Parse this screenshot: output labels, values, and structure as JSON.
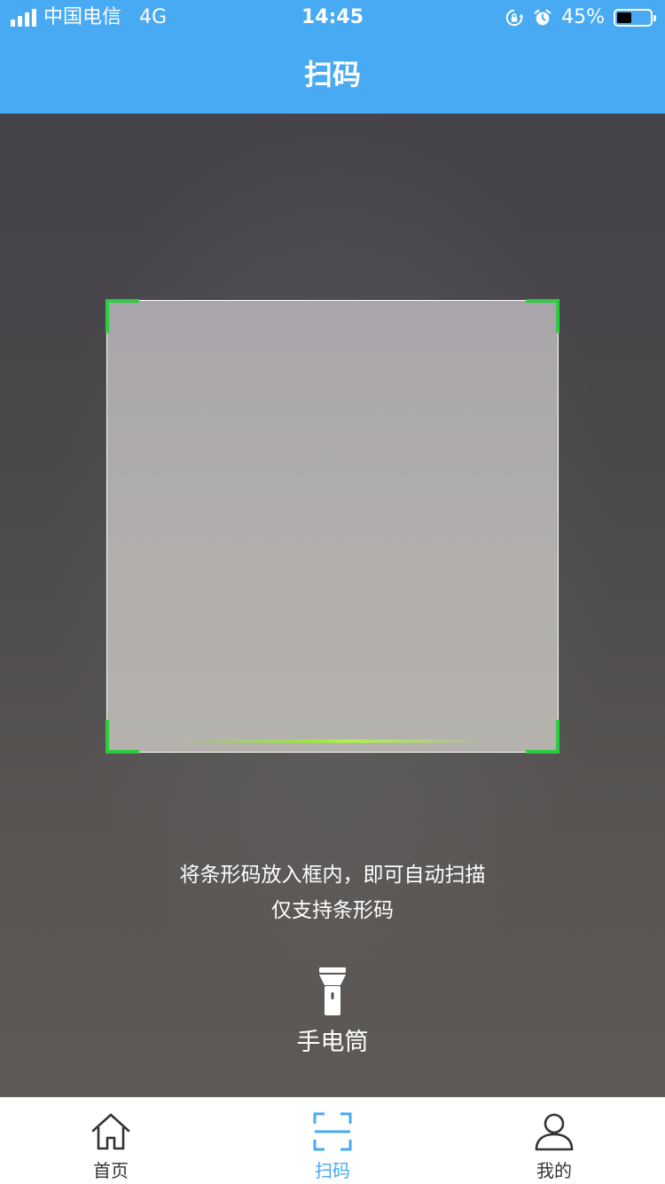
{
  "status_bar": {
    "carrier": "中国电信",
    "network": "4G",
    "time": "14:45",
    "battery_percent_text": "45%",
    "battery_level": 0.45,
    "icons": [
      "signal-icon",
      "orientation-lock-icon",
      "alarm-icon",
      "battery-icon"
    ]
  },
  "nav": {
    "title": "扫码"
  },
  "scanner": {
    "hint_line1": "将条形码放入框内，即可自动扫描",
    "hint_line2": "仅支持条形码",
    "flashlight_label": "手电筒"
  },
  "tabs": [
    {
      "label": "首页",
      "icon": "home-icon",
      "active": false
    },
    {
      "label": "扫码",
      "icon": "scan-icon",
      "active": true
    },
    {
      "label": "我的",
      "icon": "user-icon",
      "active": false
    }
  ],
  "colors": {
    "primary": "#47aaf2",
    "scan_corner": "#2ecc40",
    "scan_line": "#9be640",
    "tab_text": "#333333"
  }
}
